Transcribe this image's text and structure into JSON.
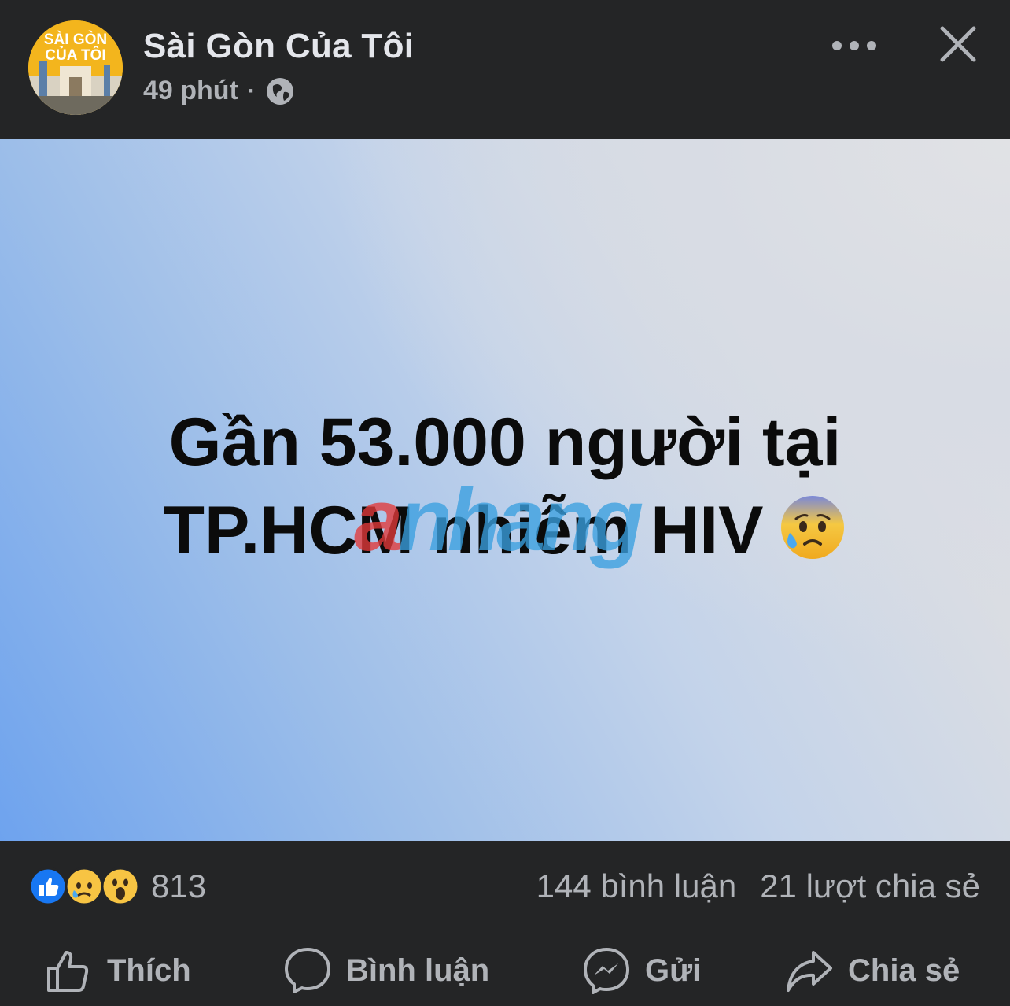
{
  "header": {
    "page_name": "Sài Gòn Của Tôi",
    "avatar_text_line1": "SÀI GÒN",
    "avatar_text_line2": "CỦA TÔI",
    "time": "49 phút",
    "separator": "·",
    "privacy_icon": "globe-icon",
    "more_icon": "more-horizontal-icon",
    "close_icon": "close-icon"
  },
  "post": {
    "line1": "Gần 53.000 người tại",
    "line2": "TP.HCM nhiễm HIV",
    "emoji": "anxious-face-with-sweat",
    "watermark_a": "a",
    "watermark_rest": "nhang"
  },
  "stats": {
    "reaction_icons": [
      "like-icon",
      "sad-icon",
      "wow-icon"
    ],
    "reaction_count": "813",
    "comments": "144 bình luận",
    "shares": "21 lượt chia sẻ"
  },
  "actions": {
    "like": "Thích",
    "comment": "Bình luận",
    "send": "Gửi",
    "share": "Chia sẻ"
  },
  "colors": {
    "background": "#242526",
    "text_primary": "#e4e6eb",
    "text_secondary": "#b0b3b8",
    "like_blue": "#1877f2"
  }
}
